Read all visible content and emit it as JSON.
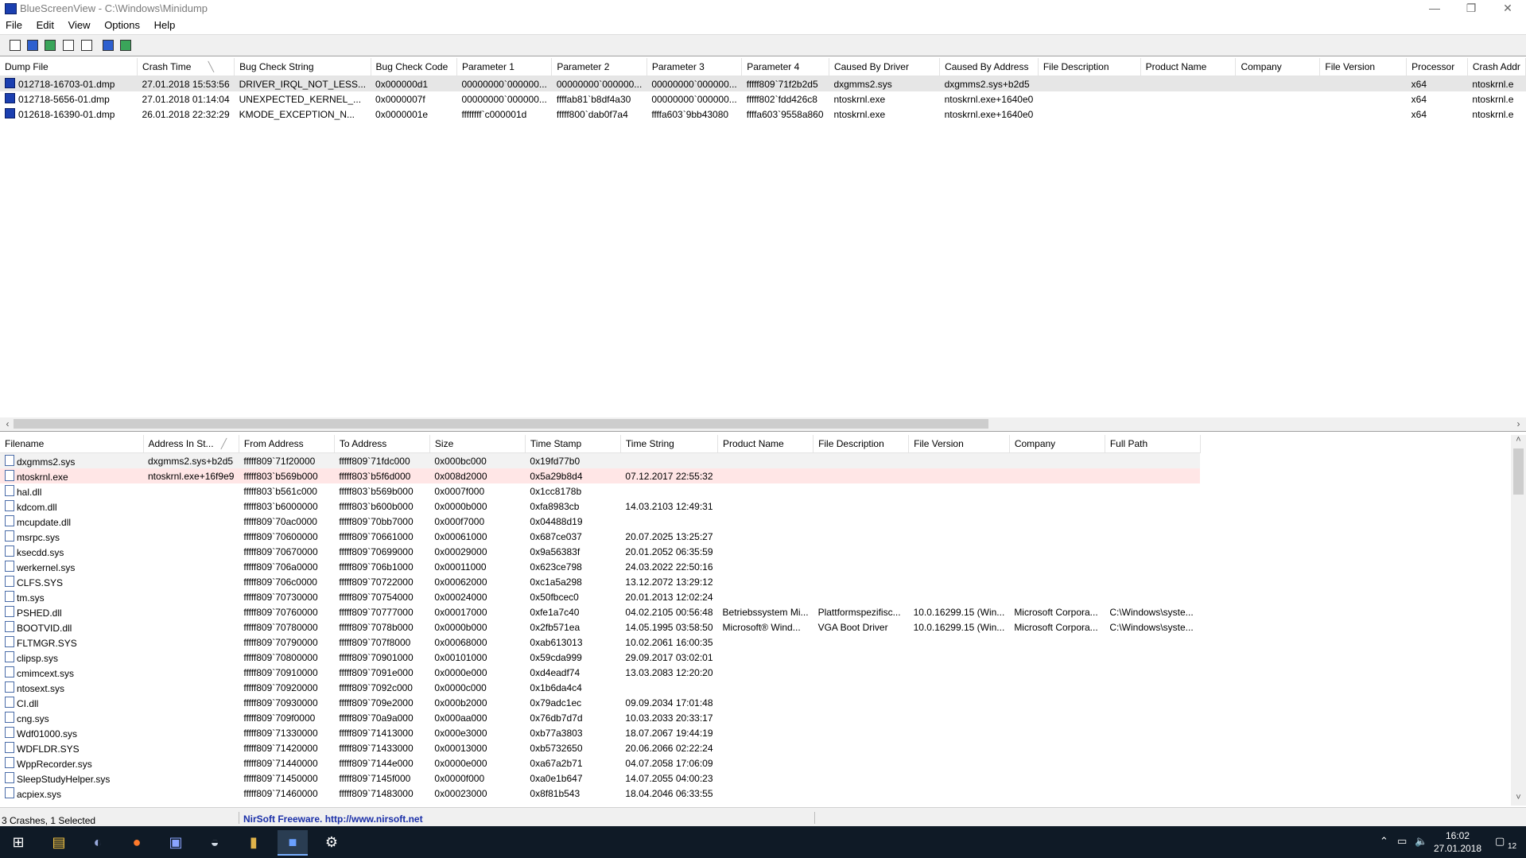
{
  "window": {
    "title": "BlueScreenView  -  C:\\Windows\\Minidump",
    "minimize": "—",
    "restore": "❐",
    "close": "✕"
  },
  "menu": [
    "File",
    "Edit",
    "View",
    "Options",
    "Help"
  ],
  "toolbar": {
    "icons": [
      "properties-icon",
      "save-icon",
      "refresh-icon",
      "copy-icon",
      "html-report-icon",
      "find-icon",
      "exit-icon"
    ]
  },
  "upper": {
    "columns": [
      "Dump File",
      "Crash Time",
      "Bug Check String",
      "Bug Check Code",
      "Parameter 1",
      "Parameter 2",
      "Parameter 3",
      "Parameter 4",
      "Caused By Driver",
      "Caused By Address",
      "File Description",
      "Product Name",
      "Company",
      "File Version",
      "Processor",
      "Crash Addr"
    ],
    "sort_indicator": "╲",
    "rows": [
      {
        "dump": "012718-16703-01.dmp",
        "time": "27.01.2018 15:53:56",
        "bug": "DRIVER_IRQL_NOT_LESS...",
        "code": "0x000000d1",
        "p1": "00000000`000000...",
        "p2": "00000000`000000...",
        "p3": "00000000`000000...",
        "p4": "fffff809`71f2b2d5",
        "driver": "dxgmms2.sys",
        "addr": "dxgmms2.sys+b2d5",
        "desc": "",
        "product": "",
        "company": "",
        "version": "",
        "cpu": "x64",
        "crash": "ntoskrnl.e"
      },
      {
        "dump": "012718-5656-01.dmp",
        "time": "27.01.2018 01:14:04",
        "bug": "UNEXPECTED_KERNEL_...",
        "code": "0x0000007f",
        "p1": "00000000`000000...",
        "p2": "ffffab81`b8df4a30",
        "p3": "00000000`000000...",
        "p4": "fffff802`fdd426c8",
        "driver": "ntoskrnl.exe",
        "addr": "ntoskrnl.exe+1640e0",
        "desc": "",
        "product": "",
        "company": "",
        "version": "",
        "cpu": "x64",
        "crash": "ntoskrnl.e"
      },
      {
        "dump": "012618-16390-01.dmp",
        "time": "26.01.2018 22:32:29",
        "bug": "KMODE_EXCEPTION_N...",
        "code": "0x0000001e",
        "p1": "ffffffff`c000001d",
        "p2": "fffff800`dab0f7a4",
        "p3": "ffffa603`9bb43080",
        "p4": "ffffa603`9558a860",
        "driver": "ntoskrnl.exe",
        "addr": "ntoskrnl.exe+1640e0",
        "desc": "",
        "product": "",
        "company": "",
        "version": "",
        "cpu": "x64",
        "crash": "ntoskrnl.e"
      }
    ]
  },
  "lower": {
    "columns": [
      "Filename",
      "Address In St...",
      "From Address",
      "To Address",
      "Size",
      "Time Stamp",
      "Time String",
      "Product Name",
      "File Description",
      "File Version",
      "Company",
      "Full Path"
    ],
    "sort_indicator": "╱",
    "rows": [
      {
        "name": "dxgmms2.sys",
        "stack": "dxgmms2.sys+b2d5",
        "from": "fffff809`71f20000",
        "to": "fffff809`71fdc000",
        "size": "0x000bc000",
        "stamp": "0x19fd77b0",
        "tstr": "",
        "product": "",
        "desc": "",
        "ver": "",
        "company": "",
        "path": ""
      },
      {
        "name": "ntoskrnl.exe",
        "stack": "ntoskrnl.exe+16f9e9",
        "from": "fffff803`b569b000",
        "to": "fffff803`b5f6d000",
        "size": "0x008d2000",
        "stamp": "0x5a29b8d4",
        "tstr": "07.12.2017 22:55:32",
        "product": "",
        "desc": "",
        "ver": "",
        "company": "",
        "path": ""
      },
      {
        "name": "hal.dll",
        "stack": "",
        "from": "fffff803`b561c000",
        "to": "fffff803`b569b000",
        "size": "0x0007f000",
        "stamp": "0x1cc8178b",
        "tstr": "",
        "product": "",
        "desc": "",
        "ver": "",
        "company": "",
        "path": ""
      },
      {
        "name": "kdcom.dll",
        "stack": "",
        "from": "fffff803`b6000000",
        "to": "fffff803`b600b000",
        "size": "0x0000b000",
        "stamp": "0xfa8983cb",
        "tstr": "14.03.2103 12:49:31",
        "product": "",
        "desc": "",
        "ver": "",
        "company": "",
        "path": ""
      },
      {
        "name": "mcupdate.dll",
        "stack": "",
        "from": "fffff809`70ac0000",
        "to": "fffff809`70bb7000",
        "size": "0x000f7000",
        "stamp": "0x04488d19",
        "tstr": "",
        "product": "",
        "desc": "",
        "ver": "",
        "company": "",
        "path": ""
      },
      {
        "name": "msrpc.sys",
        "stack": "",
        "from": "fffff809`70600000",
        "to": "fffff809`70661000",
        "size": "0x00061000",
        "stamp": "0x687ce037",
        "tstr": "20.07.2025 13:25:27",
        "product": "",
        "desc": "",
        "ver": "",
        "company": "",
        "path": ""
      },
      {
        "name": "ksecdd.sys",
        "stack": "",
        "from": "fffff809`70670000",
        "to": "fffff809`70699000",
        "size": "0x00029000",
        "stamp": "0x9a56383f",
        "tstr": "20.01.2052 06:35:59",
        "product": "",
        "desc": "",
        "ver": "",
        "company": "",
        "path": ""
      },
      {
        "name": "werkernel.sys",
        "stack": "",
        "from": "fffff809`706a0000",
        "to": "fffff809`706b1000",
        "size": "0x00011000",
        "stamp": "0x623ce798",
        "tstr": "24.03.2022 22:50:16",
        "product": "",
        "desc": "",
        "ver": "",
        "company": "",
        "path": ""
      },
      {
        "name": "CLFS.SYS",
        "stack": "",
        "from": "fffff809`706c0000",
        "to": "fffff809`70722000",
        "size": "0x00062000",
        "stamp": "0xc1a5a298",
        "tstr": "13.12.2072 13:29:12",
        "product": "",
        "desc": "",
        "ver": "",
        "company": "",
        "path": ""
      },
      {
        "name": "tm.sys",
        "stack": "",
        "from": "fffff809`70730000",
        "to": "fffff809`70754000",
        "size": "0x00024000",
        "stamp": "0x50fbcec0",
        "tstr": "20.01.2013 12:02:24",
        "product": "",
        "desc": "",
        "ver": "",
        "company": "",
        "path": ""
      },
      {
        "name": "PSHED.dll",
        "stack": "",
        "from": "fffff809`70760000",
        "to": "fffff809`70777000",
        "size": "0x00017000",
        "stamp": "0xfe1a7c40",
        "tstr": "04.02.2105 00:56:48",
        "product": "Betriebssystem Mi...",
        "desc": "Plattformspezifisc...",
        "ver": "10.0.16299.15 (Win...",
        "company": "Microsoft Corpora...",
        "path": "C:\\Windows\\syste..."
      },
      {
        "name": "BOOTVID.dll",
        "stack": "",
        "from": "fffff809`70780000",
        "to": "fffff809`7078b000",
        "size": "0x0000b000",
        "stamp": "0x2fb571ea",
        "tstr": "14.05.1995 03:58:50",
        "product": "Microsoft® Wind...",
        "desc": "VGA Boot Driver",
        "ver": "10.0.16299.15 (Win...",
        "company": "Microsoft Corpora...",
        "path": "C:\\Windows\\syste..."
      },
      {
        "name": "FLTMGR.SYS",
        "stack": "",
        "from": "fffff809`70790000",
        "to": "fffff809`707f8000",
        "size": "0x00068000",
        "stamp": "0xab613013",
        "tstr": "10.02.2061 16:00:35",
        "product": "",
        "desc": "",
        "ver": "",
        "company": "",
        "path": ""
      },
      {
        "name": "clipsp.sys",
        "stack": "",
        "from": "fffff809`70800000",
        "to": "fffff809`70901000",
        "size": "0x00101000",
        "stamp": "0x59cda999",
        "tstr": "29.09.2017 03:02:01",
        "product": "",
        "desc": "",
        "ver": "",
        "company": "",
        "path": ""
      },
      {
        "name": "cmimcext.sys",
        "stack": "",
        "from": "fffff809`70910000",
        "to": "fffff809`7091e000",
        "size": "0x0000e000",
        "stamp": "0xd4eadf74",
        "tstr": "13.03.2083 12:20:20",
        "product": "",
        "desc": "",
        "ver": "",
        "company": "",
        "path": ""
      },
      {
        "name": "ntosext.sys",
        "stack": "",
        "from": "fffff809`70920000",
        "to": "fffff809`7092c000",
        "size": "0x0000c000",
        "stamp": "0x1b6da4c4",
        "tstr": "",
        "product": "",
        "desc": "",
        "ver": "",
        "company": "",
        "path": ""
      },
      {
        "name": "CI.dll",
        "stack": "",
        "from": "fffff809`70930000",
        "to": "fffff809`709e2000",
        "size": "0x000b2000",
        "stamp": "0x79adc1ec",
        "tstr": "09.09.2034 17:01:48",
        "product": "",
        "desc": "",
        "ver": "",
        "company": "",
        "path": ""
      },
      {
        "name": "cng.sys",
        "stack": "",
        "from": "fffff809`709f0000",
        "to": "fffff809`70a9a000",
        "size": "0x000aa000",
        "stamp": "0x76db7d7d",
        "tstr": "10.03.2033 20:33:17",
        "product": "",
        "desc": "",
        "ver": "",
        "company": "",
        "path": ""
      },
      {
        "name": "Wdf01000.sys",
        "stack": "",
        "from": "fffff809`71330000",
        "to": "fffff809`71413000",
        "size": "0x000e3000",
        "stamp": "0xb77a3803",
        "tstr": "18.07.2067 19:44:19",
        "product": "",
        "desc": "",
        "ver": "",
        "company": "",
        "path": ""
      },
      {
        "name": "WDFLDR.SYS",
        "stack": "",
        "from": "fffff809`71420000",
        "to": "fffff809`71433000",
        "size": "0x00013000",
        "stamp": "0xb5732650",
        "tstr": "20.06.2066 02:22:24",
        "product": "",
        "desc": "",
        "ver": "",
        "company": "",
        "path": ""
      },
      {
        "name": "WppRecorder.sys",
        "stack": "",
        "from": "fffff809`71440000",
        "to": "fffff809`7144e000",
        "size": "0x0000e000",
        "stamp": "0xa67a2b71",
        "tstr": "04.07.2058 17:06:09",
        "product": "",
        "desc": "",
        "ver": "",
        "company": "",
        "path": ""
      },
      {
        "name": "SleepStudyHelper.sys",
        "stack": "",
        "from": "fffff809`71450000",
        "to": "fffff809`7145f000",
        "size": "0x0000f000",
        "stamp": "0xa0e1b647",
        "tstr": "14.07.2055 04:00:23",
        "product": "",
        "desc": "",
        "ver": "",
        "company": "",
        "path": ""
      },
      {
        "name": "acpiex.sys",
        "stack": "",
        "from": "fffff809`71460000",
        "to": "fffff809`71483000",
        "size": "0x00023000",
        "stamp": "0x8f81b543",
        "tstr": "18.04.2046 06:33:55",
        "product": "",
        "desc": "",
        "ver": "",
        "company": "",
        "path": ""
      }
    ]
  },
  "status": {
    "left": "3 Crashes, 1 Selected",
    "link": "NirSoft Freeware.  http://www.nirsoft.net"
  },
  "taskbar": {
    "apps": [
      "start-icon",
      "file-explorer-icon",
      "app-icon",
      "firefox-icon",
      "discord-icon",
      "steam-icon",
      "winrar-icon",
      "bluescreenview-icon",
      "settings-icon"
    ],
    "time": "16:02",
    "date": "27.01.2018",
    "notifications": "12"
  },
  "colors": {
    "selected_row": "#e6e6e6",
    "highlight_row": "#ffe6e6",
    "link": "#1a2fa8",
    "taskbar": "#0f1a26"
  }
}
